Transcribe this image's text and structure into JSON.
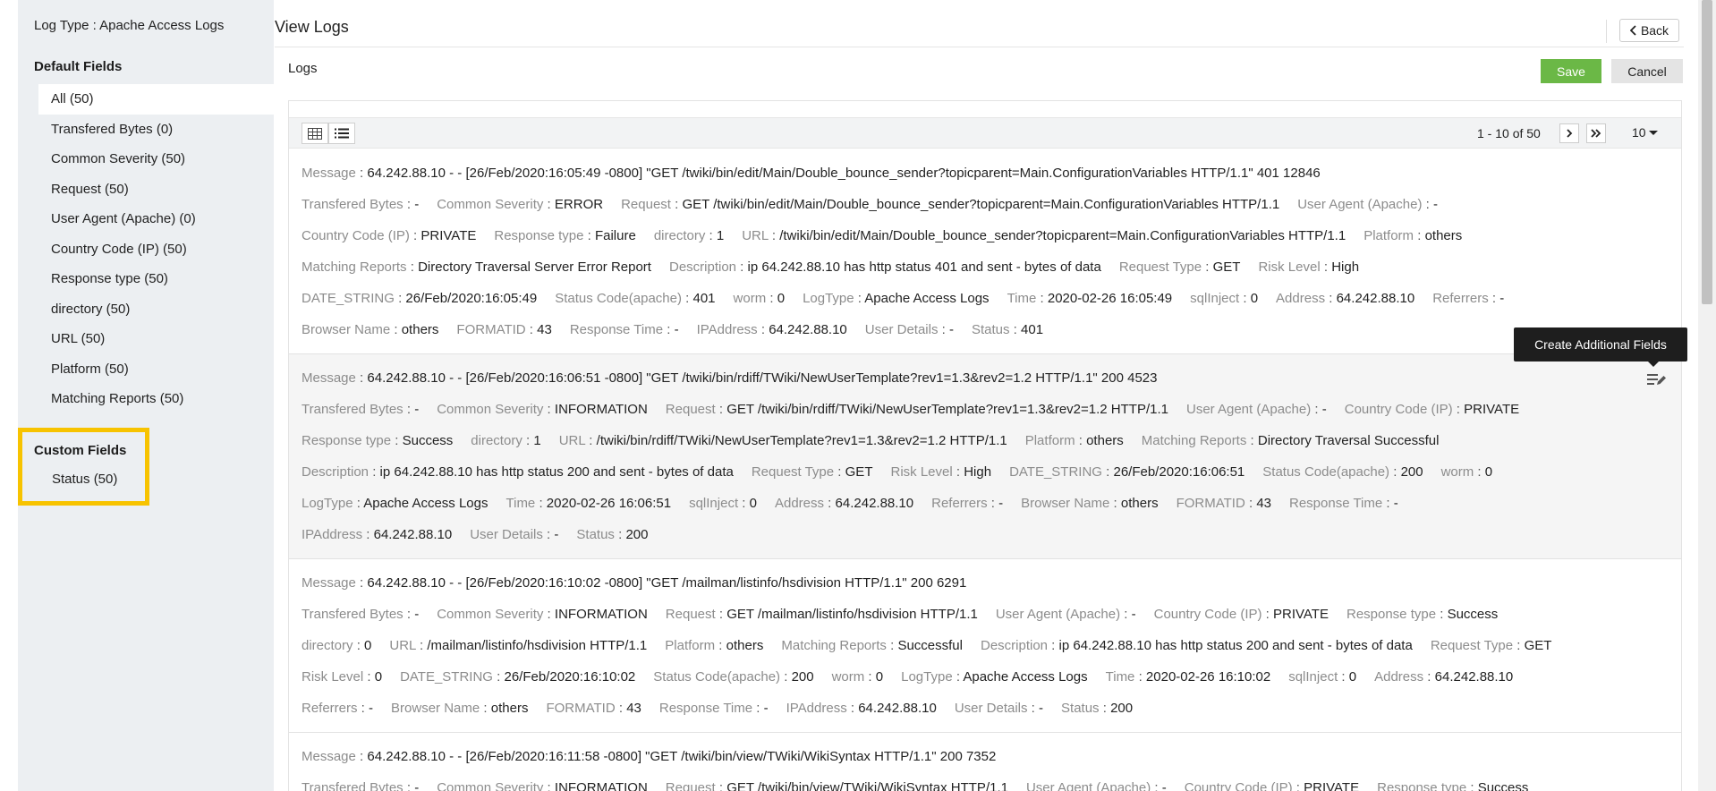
{
  "sidebar": {
    "log_type": "Log Type : Apache Access Logs",
    "default_title": "Default Fields",
    "fields": [
      {
        "label": "All (50)",
        "active": true
      },
      {
        "label": "Transfered Bytes (0)"
      },
      {
        "label": "Common Severity (50)"
      },
      {
        "label": "Request (50)"
      },
      {
        "label": "User Agent (Apache) (0)"
      },
      {
        "label": "Country Code (IP) (50)"
      },
      {
        "label": "Response type (50)"
      },
      {
        "label": "directory (50)"
      },
      {
        "label": "URL (50)"
      },
      {
        "label": "Platform (50)"
      },
      {
        "label": "Matching Reports (50)"
      }
    ],
    "custom_title": "Custom Fields",
    "custom_fields": [
      {
        "label": "Status (50)"
      }
    ],
    "highlight_color": "#f7c300"
  },
  "header": {
    "title": "View Logs",
    "back_label": "Back"
  },
  "logs": {
    "label": "Logs",
    "save_label": "Save",
    "cancel_label": "Cancel",
    "pager_text": "1 - 10 of 50",
    "page_size": "10",
    "tooltip": "Create Additional Fields",
    "entries": [
      {
        "lines": [
          [
            [
              "Message",
              "64.242.88.10 - - [26/Feb/2020:16:05:49 -0800] \"GET /twiki/bin/edit/Main/Double_bounce_sender?topicparent=Main.ConfigurationVariables HTTP/1.1\" 401 12846"
            ]
          ],
          [
            [
              "Transfered Bytes",
              "-"
            ],
            [
              "Common Severity",
              "ERROR"
            ],
            [
              "Request",
              "GET /twiki/bin/edit/Main/Double_bounce_sender?topicparent=Main.ConfigurationVariables HTTP/1.1"
            ],
            [
              "User Agent (Apache)",
              "-"
            ]
          ],
          [
            [
              "Country Code (IP)",
              "PRIVATE"
            ],
            [
              "Response type",
              "Failure"
            ],
            [
              "directory",
              "1"
            ],
            [
              "URL",
              "/twiki/bin/edit/Main/Double_bounce_sender?topicparent=Main.ConfigurationVariables HTTP/1.1"
            ],
            [
              "Platform",
              "others"
            ]
          ],
          [
            [
              "Matching Reports",
              "Directory Traversal Server Error Report"
            ],
            [
              "Description",
              "ip 64.242.88.10 has http status 401 and sent - bytes of data"
            ],
            [
              "Request Type",
              "GET"
            ],
            [
              "Risk Level",
              "High"
            ]
          ],
          [
            [
              "DATE_STRING",
              "26/Feb/2020:16:05:49"
            ],
            [
              "Status Code(apache)",
              "401"
            ],
            [
              "worm",
              "0"
            ],
            [
              "LogType",
              "Apache Access Logs"
            ],
            [
              "Time",
              "2020-02-26 16:05:49"
            ],
            [
              "sqlInject",
              "0"
            ],
            [
              "Address",
              "64.242.88.10"
            ],
            [
              "Referrers",
              "-"
            ]
          ],
          [
            [
              "Browser Name",
              "others"
            ],
            [
              "FORMATID",
              "43"
            ],
            [
              "Response Time",
              "-"
            ],
            [
              "IPAddress",
              "64.242.88.10"
            ],
            [
              "User Details",
              "-"
            ],
            [
              "Status",
              "401"
            ]
          ]
        ]
      },
      {
        "highlight": true,
        "lines": [
          [
            [
              "Message",
              "64.242.88.10 - - [26/Feb/2020:16:06:51 -0800] \"GET /twiki/bin/rdiff/TWiki/NewUserTemplate?rev1=1.3&rev2=1.2 HTTP/1.1\" 200 4523"
            ]
          ],
          [
            [
              "Transfered Bytes",
              "-"
            ],
            [
              "Common Severity",
              "INFORMATION"
            ],
            [
              "Request",
              "GET /twiki/bin/rdiff/TWiki/NewUserTemplate?rev1=1.3&rev2=1.2 HTTP/1.1"
            ],
            [
              "User Agent (Apache)",
              "-"
            ],
            [
              "Country Code (IP)",
              "PRIVATE"
            ]
          ],
          [
            [
              "Response type",
              "Success"
            ],
            [
              "directory",
              "1"
            ],
            [
              "URL",
              "/twiki/bin/rdiff/TWiki/NewUserTemplate?rev1=1.3&rev2=1.2 HTTP/1.1"
            ],
            [
              "Platform",
              "others"
            ],
            [
              "Matching Reports",
              "Directory Traversal Successful"
            ]
          ],
          [
            [
              "Description",
              "ip 64.242.88.10 has http status 200 and sent - bytes of data"
            ],
            [
              "Request Type",
              "GET"
            ],
            [
              "Risk Level",
              "High"
            ],
            [
              "DATE_STRING",
              "26/Feb/2020:16:06:51"
            ],
            [
              "Status Code(apache)",
              "200"
            ],
            [
              "worm",
              "0"
            ]
          ],
          [
            [
              "LogType",
              "Apache Access Logs"
            ],
            [
              "Time",
              "2020-02-26 16:06:51"
            ],
            [
              "sqlInject",
              "0"
            ],
            [
              "Address",
              "64.242.88.10"
            ],
            [
              "Referrers",
              "-"
            ],
            [
              "Browser Name",
              "others"
            ],
            [
              "FORMATID",
              "43"
            ],
            [
              "Response Time",
              "-"
            ]
          ],
          [
            [
              "IPAddress",
              "64.242.88.10"
            ],
            [
              "User Details",
              "-"
            ],
            [
              "Status",
              "200"
            ]
          ]
        ]
      },
      {
        "lines": [
          [
            [
              "Message",
              "64.242.88.10 - - [26/Feb/2020:16:10:02 -0800] \"GET /mailman/listinfo/hsdivision HTTP/1.1\" 200 6291"
            ]
          ],
          [
            [
              "Transfered Bytes",
              "-"
            ],
            [
              "Common Severity",
              "INFORMATION"
            ],
            [
              "Request",
              "GET /mailman/listinfo/hsdivision HTTP/1.1"
            ],
            [
              "User Agent (Apache)",
              "-"
            ],
            [
              "Country Code (IP)",
              "PRIVATE"
            ],
            [
              "Response type",
              "Success"
            ]
          ],
          [
            [
              "directory",
              "0"
            ],
            [
              "URL",
              "/mailman/listinfo/hsdivision HTTP/1.1"
            ],
            [
              "Platform",
              "others"
            ],
            [
              "Matching Reports",
              "Successful"
            ],
            [
              "Description",
              "ip 64.242.88.10 has http status 200 and sent - bytes of data"
            ],
            [
              "Request Type",
              "GET"
            ]
          ],
          [
            [
              "Risk Level",
              "0"
            ],
            [
              "DATE_STRING",
              "26/Feb/2020:16:10:02"
            ],
            [
              "Status Code(apache)",
              "200"
            ],
            [
              "worm",
              "0"
            ],
            [
              "LogType",
              "Apache Access Logs"
            ],
            [
              "Time",
              "2020-02-26 16:10:02"
            ],
            [
              "sqlInject",
              "0"
            ],
            [
              "Address",
              "64.242.88.10"
            ]
          ],
          [
            [
              "Referrers",
              "-"
            ],
            [
              "Browser Name",
              "others"
            ],
            [
              "FORMATID",
              "43"
            ],
            [
              "Response Time",
              "-"
            ],
            [
              "IPAddress",
              "64.242.88.10"
            ],
            [
              "User Details",
              "-"
            ],
            [
              "Status",
              "200"
            ]
          ]
        ]
      },
      {
        "lines": [
          [
            [
              "Message",
              "64.242.88.10 - - [26/Feb/2020:16:11:58 -0800] \"GET /twiki/bin/view/TWiki/WikiSyntax HTTP/1.1\" 200 7352"
            ]
          ],
          [
            [
              "Transfered Bytes",
              "-"
            ],
            [
              "Common Severity",
              "INFORMATION"
            ],
            [
              "Request",
              "GET /twiki/bin/view/TWiki/WikiSyntax HTTP/1.1"
            ],
            [
              "User Agent (Apache)",
              "-"
            ],
            [
              "Country Code (IP)",
              "PRIVATE"
            ],
            [
              "Response type",
              "Success"
            ]
          ]
        ]
      }
    ]
  },
  "colors": {
    "save_green": "#6bb846",
    "sidebar_bg": "#eceff2",
    "tooltip_bg": "#1e1e1e"
  }
}
